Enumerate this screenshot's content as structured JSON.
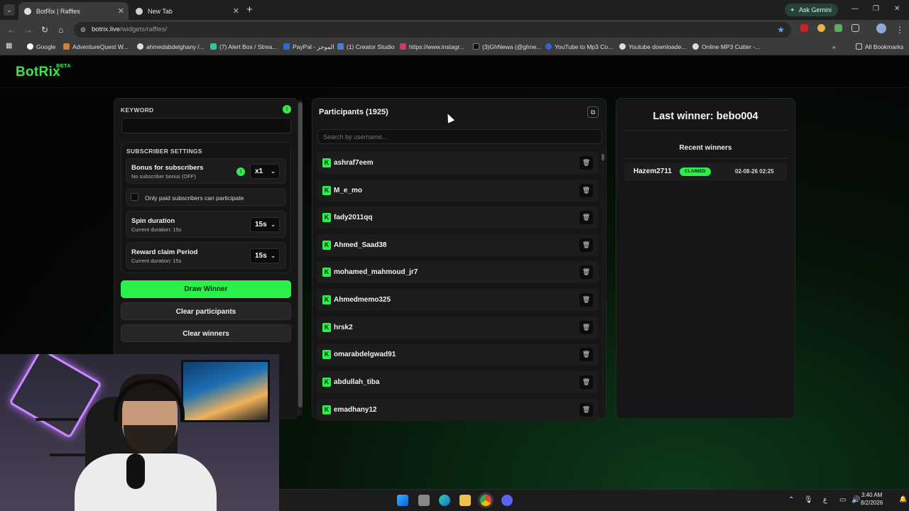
{
  "browser": {
    "tabs": [
      {
        "label": "BotRix | Raffles"
      },
      {
        "label": "New Tab"
      }
    ],
    "ask_gemini": "Ask Gemini",
    "url_domain": "botrix.live",
    "url_path": "/widgets/raffles/",
    "bookmarks": [
      {
        "label": "Google",
        "color": "#ffffff"
      },
      {
        "label": "AdventureQuest W...",
        "color": "#e07b2a"
      },
      {
        "label": "ahmedabdelghany /...",
        "color": "#dddddd"
      },
      {
        "label": "(7) Alert Box / Strea...",
        "color": "#31c3a2"
      },
      {
        "label": "PayPal - الموجز",
        "color": "#2a6bd6"
      },
      {
        "label": "(1) Creator Studio",
        "color": "#4b7cd9"
      },
      {
        "label": "https://www.instagr...",
        "color": "#d6326e"
      },
      {
        "label": "(3)GhNewa (@ghne...",
        "color": "#111111"
      },
      {
        "label": "YouTube to Mp3 Co...",
        "color": "#3d5ed6"
      },
      {
        "label": "Youtube downloade...",
        "color": "#dddddd"
      },
      {
        "label": "Online MP3 Cutter -...",
        "color": "#dddddd"
      }
    ],
    "all_bookmarks": "All Bookmarks"
  },
  "app": {
    "logo": "BotRix",
    "logo_badge": "BETA",
    "accent": "#2bf04a"
  },
  "settings": {
    "keyword_label": "KEYWORD",
    "keyword_value": "",
    "subscriber_settings_label": "SUBSCRIBER SETTINGS",
    "bonus_title": "Bonus for subscribers",
    "bonus_sub": "No subscriber bonus (OFF)",
    "bonus_value": "x1",
    "paid_only_label": "Only paid subscribers can participate",
    "spin_title": "Spin duration",
    "spin_sub": "Current duration: 15s",
    "spin_value": "15s",
    "claim_title": "Reward claim Period",
    "claim_sub": "Current duration: 15s",
    "claim_value": "15s",
    "draw_button": "Draw Winner",
    "clear_participants_button": "Clear participants",
    "clear_winners_button": "Clear winners"
  },
  "participants": {
    "title": "Participants (1925)",
    "search_placeholder": "Search by username...",
    "items": [
      "ashraf7eem",
      "M_e_mo",
      "fady2011qq",
      "Ahmed_Saad38",
      "mohamed_mahmoud_jr7",
      "Ahmedmemo325",
      "hrsk2",
      "omarabdelgwad91",
      "abdullah_tiba",
      "emadhany12"
    ]
  },
  "winners": {
    "last_winner": "Last winner: bebo004",
    "recent_title": "Recent winners",
    "recent": [
      {
        "name": "Hazem2711",
        "status": "CLAIMED",
        "date": "02-08-26 02:25"
      }
    ]
  },
  "taskbar": {
    "time": "3:40 AM",
    "date": "8/2/2026",
    "lang": "ع"
  }
}
